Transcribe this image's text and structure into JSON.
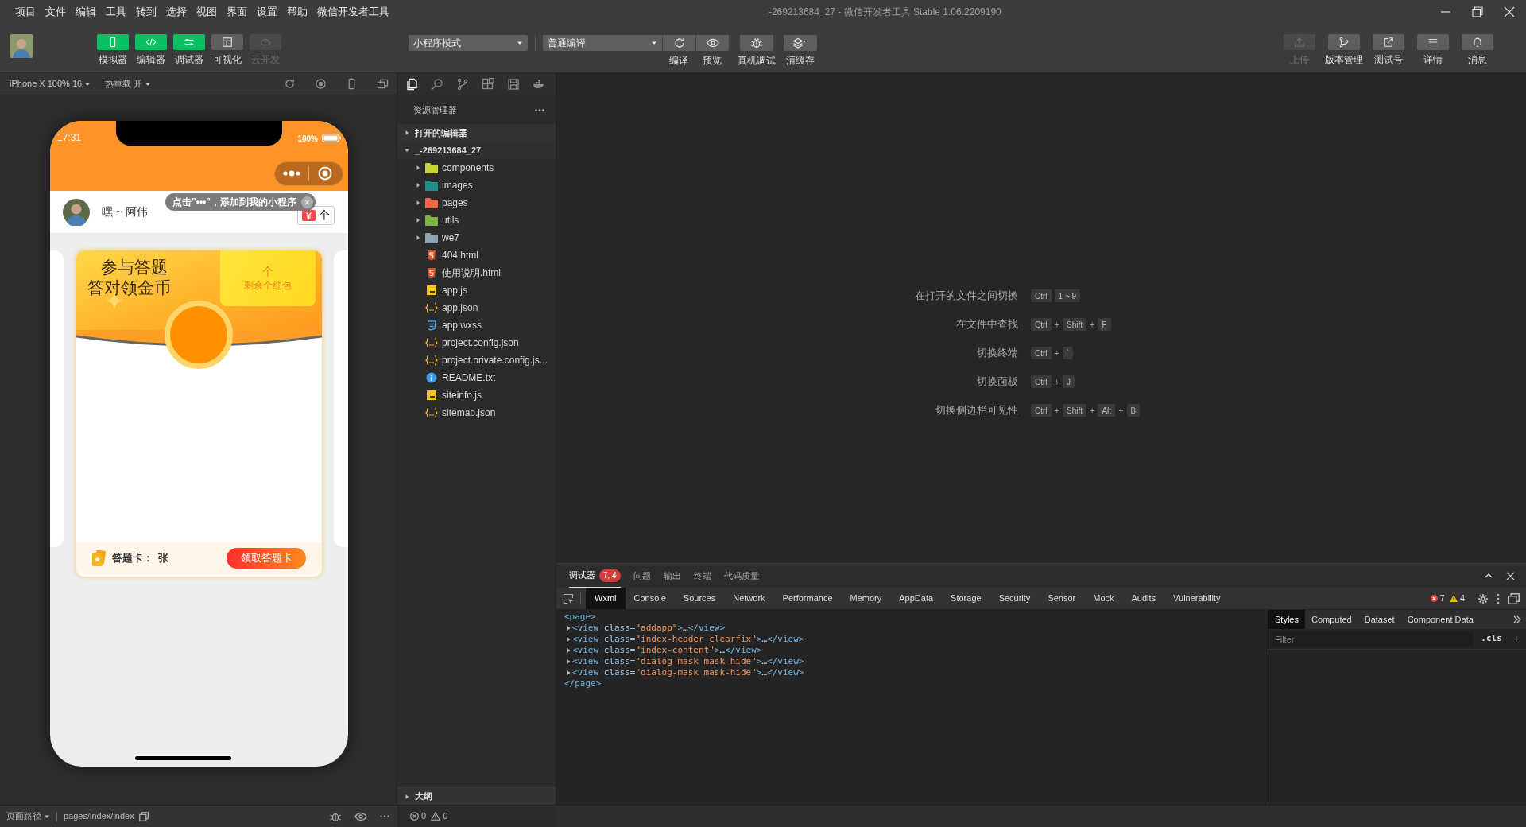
{
  "menu_bar": {
    "items": [
      "项目",
      "文件",
      "编辑",
      "工具",
      "转到",
      "选择",
      "视图",
      "界面",
      "设置",
      "帮助",
      "微信开发者工具"
    ],
    "title": "_-269213684_27 - 微信开发者工具 Stable 1.06.2209190"
  },
  "toolbar": {
    "view_toggles": [
      {
        "label": "模拟器",
        "on": true,
        "disabled": false
      },
      {
        "label": "编辑器",
        "on": true,
        "disabled": false
      },
      {
        "label": "调试器",
        "on": true,
        "disabled": false
      },
      {
        "label": "可视化",
        "on": false,
        "disabled": false
      },
      {
        "label": "云开发",
        "on": false,
        "disabled": true
      }
    ],
    "mode_dropdown": "小程序模式",
    "compile_dropdown": "普通编译",
    "actions": [
      "编译",
      "预览",
      "真机调试",
      "清缓存"
    ],
    "right_buttons": [
      {
        "label": "上传",
        "disabled": true
      },
      {
        "label": "版本管理",
        "disabled": false
      },
      {
        "label": "测试号",
        "disabled": false
      },
      {
        "label": "详情",
        "disabled": false
      },
      {
        "label": "消息",
        "disabled": false
      }
    ]
  },
  "simulator": {
    "device": "iPhone X 100% 16",
    "hot_reload": "热重载 开",
    "phone": {
      "time": "17:31",
      "battery": "100%",
      "tooltip": "点击\"•••\"，添加到我的小程序",
      "user_name": "嘿 ~ 阿伟",
      "gift_count": "个",
      "card": {
        "title_lines": [
          "参与答题",
          "答对领金币"
        ],
        "red_packet_count": "个",
        "red_packet_label": "剩余个红包",
        "card_label": "答题卡：",
        "card_count": "张",
        "claim_button": "领取答题卡"
      }
    }
  },
  "explorer": {
    "title": "资源管理器",
    "sections": [
      {
        "label": "打开的编辑器",
        "expanded": false
      },
      {
        "label": "_-269213684_27",
        "expanded": true,
        "children": [
          {
            "name": "components",
            "kind": "folder",
            "expanded": false,
            "color": "#c6d43a"
          },
          {
            "name": "images",
            "kind": "folder",
            "expanded": false,
            "color": "#1e8f86"
          },
          {
            "name": "pages",
            "kind": "folder",
            "expanded": false,
            "color": "#f2674a"
          },
          {
            "name": "utils",
            "kind": "folder",
            "expanded": false,
            "color": "#7cb342"
          },
          {
            "name": "we7",
            "kind": "folder",
            "expanded": false,
            "color": "#90a4ae"
          },
          {
            "name": "404.html",
            "kind": "html"
          },
          {
            "name": "使用说明.html",
            "kind": "html"
          },
          {
            "name": "app.js",
            "kind": "js"
          },
          {
            "name": "app.json",
            "kind": "json"
          },
          {
            "name": "app.wxss",
            "kind": "wxss"
          },
          {
            "name": "project.config.json",
            "kind": "json"
          },
          {
            "name": "project.private.config.js...",
            "kind": "json"
          },
          {
            "name": "README.txt",
            "kind": "info"
          },
          {
            "name": "siteinfo.js",
            "kind": "js"
          },
          {
            "name": "sitemap.json",
            "kind": "json"
          }
        ]
      }
    ],
    "outline": {
      "label": "大纲",
      "expanded": false
    }
  },
  "editor": {
    "shortcuts": [
      {
        "label": "在打开的文件之间切换",
        "keys": [
          {
            "kind": "key",
            "text": "Ctrl"
          },
          {
            "kind": "key",
            "text": "1 ~ 9"
          }
        ]
      },
      {
        "label": "在文件中查找",
        "keys": [
          {
            "kind": "key",
            "text": "Ctrl"
          },
          {
            "kind": "plus",
            "text": "+"
          },
          {
            "kind": "key",
            "text": "Shift"
          },
          {
            "kind": "plus",
            "text": "+"
          },
          {
            "kind": "key",
            "text": "F"
          }
        ]
      },
      {
        "label": "切换终端",
        "keys": [
          {
            "kind": "key",
            "text": "Ctrl"
          },
          {
            "kind": "plus",
            "text": "+"
          },
          {
            "kind": "key",
            "text": "`"
          }
        ]
      },
      {
        "label": "切换面板",
        "keys": [
          {
            "kind": "key",
            "text": "Ctrl"
          },
          {
            "kind": "plus",
            "text": "+"
          },
          {
            "kind": "key",
            "text": "J"
          }
        ]
      },
      {
        "label": "切换侧边栏可见性",
        "keys": [
          {
            "kind": "key",
            "text": "Ctrl"
          },
          {
            "kind": "plus",
            "text": "+"
          },
          {
            "kind": "key",
            "text": "Shift"
          },
          {
            "kind": "plus",
            "text": "+"
          },
          {
            "kind": "key",
            "text": "Alt"
          },
          {
            "kind": "plus",
            "text": "+"
          },
          {
            "kind": "key",
            "text": "B"
          }
        ]
      }
    ]
  },
  "debugger": {
    "panel_tabs": [
      {
        "label": "调试器",
        "selected": true,
        "badge": "7, 4"
      },
      {
        "label": "问题",
        "selected": false
      },
      {
        "label": "输出",
        "selected": false
      },
      {
        "label": "终端",
        "selected": false
      },
      {
        "label": "代码质量",
        "selected": false
      }
    ],
    "devtools_tabs": [
      {
        "label": "Wxml",
        "selected": true
      },
      {
        "label": "Console",
        "selected": false
      },
      {
        "label": "Sources",
        "selected": false
      },
      {
        "label": "Network",
        "selected": false
      },
      {
        "label": "Performance",
        "selected": false
      },
      {
        "label": "Memory",
        "selected": false
      },
      {
        "label": "AppData",
        "selected": false
      },
      {
        "label": "Storage",
        "selected": false
      },
      {
        "label": "Security",
        "selected": false
      },
      {
        "label": "Sensor",
        "selected": false
      },
      {
        "label": "Mock",
        "selected": false
      },
      {
        "label": "Audits",
        "selected": false
      },
      {
        "label": "Vulnerability",
        "selected": false
      }
    ],
    "error_count": "7",
    "warning_count": "4",
    "wxml_lines": [
      {
        "collapsed": false,
        "parts": [
          {
            "kind": "tag",
            "text": "<page>"
          }
        ]
      },
      {
        "collapsed": true,
        "parts": [
          {
            "kind": "tag",
            "text": "<view"
          },
          {
            "kind": "attr",
            "text": " class="
          },
          {
            "kind": "value",
            "text": "\"addapp\""
          },
          {
            "kind": "tag",
            "text": ">"
          },
          {
            "kind": "ellipsis",
            "text": "…"
          },
          {
            "kind": "tag",
            "text": "</view>"
          }
        ]
      },
      {
        "collapsed": true,
        "parts": [
          {
            "kind": "tag",
            "text": "<view"
          },
          {
            "kind": "attr",
            "text": " class="
          },
          {
            "kind": "value",
            "text": "\"index-header clearfix\""
          },
          {
            "kind": "tag",
            "text": ">"
          },
          {
            "kind": "ellipsis",
            "text": "…"
          },
          {
            "kind": "tag",
            "text": "</view>"
          }
        ]
      },
      {
        "collapsed": true,
        "parts": [
          {
            "kind": "tag",
            "text": "<view"
          },
          {
            "kind": "attr",
            "text": " class="
          },
          {
            "kind": "value",
            "text": "\"index-content\""
          },
          {
            "kind": "tag",
            "text": ">"
          },
          {
            "kind": "ellipsis",
            "text": "…"
          },
          {
            "kind": "tag",
            "text": "</view>"
          }
        ]
      },
      {
        "collapsed": true,
        "parts": [
          {
            "kind": "tag",
            "text": "<view"
          },
          {
            "kind": "attr",
            "text": " class="
          },
          {
            "kind": "value",
            "text": "\"dialog-mask mask-hide\""
          },
          {
            "kind": "tag",
            "text": ">"
          },
          {
            "kind": "ellipsis",
            "text": "…"
          },
          {
            "kind": "tag",
            "text": "</view>"
          }
        ]
      },
      {
        "collapsed": true,
        "parts": [
          {
            "kind": "tag",
            "text": "<view"
          },
          {
            "kind": "attr",
            "text": " class="
          },
          {
            "kind": "value",
            "text": "\"dialog-mask mask-hide\""
          },
          {
            "kind": "tag",
            "text": ">"
          },
          {
            "kind": "ellipsis",
            "text": "…"
          },
          {
            "kind": "tag",
            "text": "</view>"
          }
        ]
      },
      {
        "collapsed": false,
        "parts": [
          {
            "kind": "tag",
            "text": "</page>"
          }
        ]
      }
    ],
    "styles_tabs": [
      {
        "label": "Styles",
        "selected": true
      },
      {
        "label": "Computed",
        "selected": false
      },
      {
        "label": "Dataset",
        "selected": false
      },
      {
        "label": "Component Data",
        "selected": false
      }
    ],
    "filter_placeholder": "Filter",
    "cls_toggle": ".cls",
    "add_rule": "+"
  },
  "status_bar": {
    "page_path_label": "页面路径",
    "page_path": "pages/index/index",
    "errors": "0",
    "warnings": "0"
  }
}
